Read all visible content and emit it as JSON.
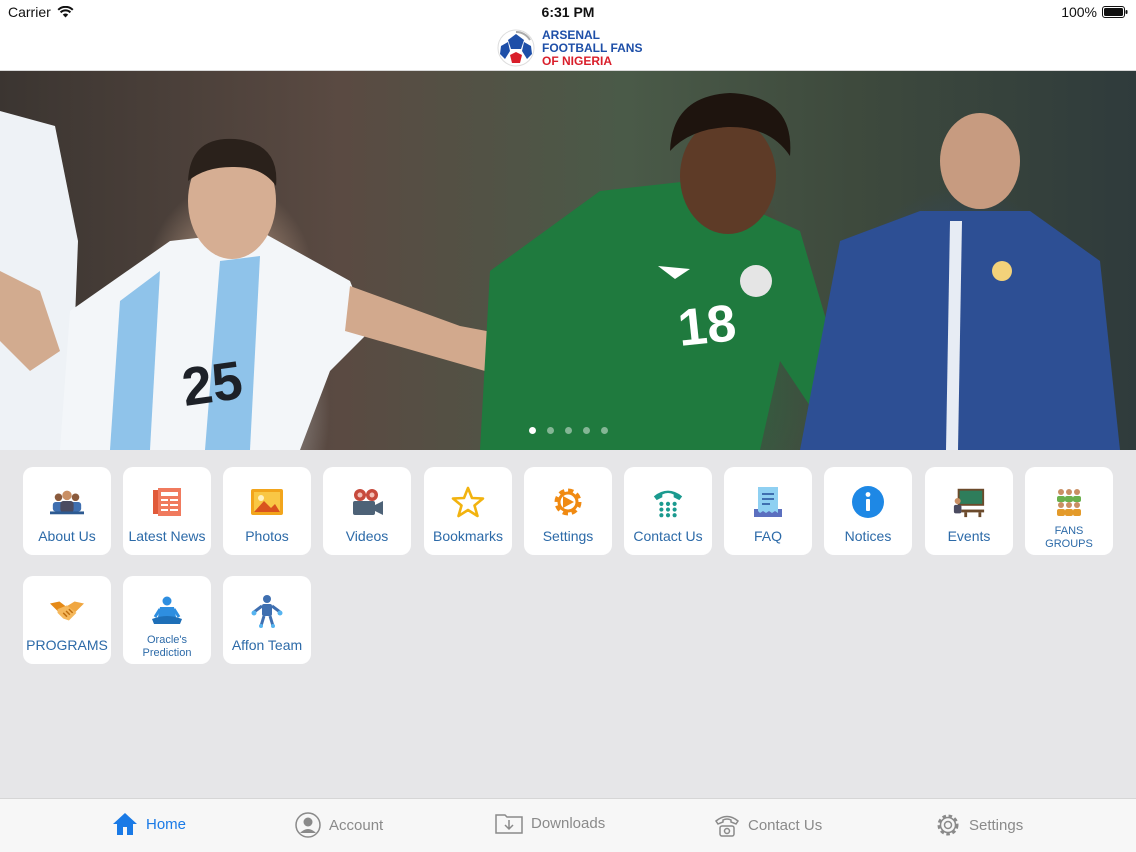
{
  "status": {
    "carrier": "Carrier",
    "time": "6:31 PM",
    "battery": "100%"
  },
  "header": {
    "logo_line1": "ARSENAL",
    "logo_line2": "FOOTBALL FANS",
    "logo_line3": "OF NIGERIA"
  },
  "hero": {
    "jersey_left": "25",
    "jersey_right": "18",
    "slide_count": 5,
    "active_slide": 1
  },
  "tiles": [
    {
      "label": "About Us",
      "icon": "group-icon"
    },
    {
      "label": "Latest News",
      "icon": "newspaper-icon"
    },
    {
      "label": "Photos",
      "icon": "photo-icon"
    },
    {
      "label": "Videos",
      "icon": "video-camera-icon"
    },
    {
      "label": "Bookmarks",
      "icon": "star-icon"
    },
    {
      "label": "Settings",
      "icon": "gear-icon"
    },
    {
      "label": "Contact Us",
      "icon": "telephone-icon"
    },
    {
      "label": "FAQ",
      "icon": "faq-document-icon"
    },
    {
      "label": "Notices",
      "icon": "info-icon"
    },
    {
      "label": "Events",
      "icon": "presentation-icon"
    },
    {
      "label": "FANS GROUPS",
      "icon": "fans-groups-icon"
    },
    {
      "label": "PROGRAMS",
      "icon": "handshake-icon"
    },
    {
      "label": "Oracle's Prediction",
      "icon": "meditation-icon"
    },
    {
      "label": "Affon Team",
      "icon": "team-member-icon"
    }
  ],
  "tabbar": [
    {
      "label": "Home",
      "icon": "home-icon",
      "active": true
    },
    {
      "label": "Account",
      "icon": "account-icon",
      "active": false
    },
    {
      "label": "Downloads",
      "icon": "download-folder-icon",
      "active": false
    },
    {
      "label": "Contact Us",
      "icon": "phone-icon",
      "active": false
    },
    {
      "label": "Settings",
      "icon": "gear-icon",
      "active": false
    }
  ],
  "colors": {
    "accent": "#1a7ae6",
    "tile_label": "#2c6aa8",
    "logo_blue": "#1e4fa8",
    "logo_red": "#d91e2a"
  }
}
